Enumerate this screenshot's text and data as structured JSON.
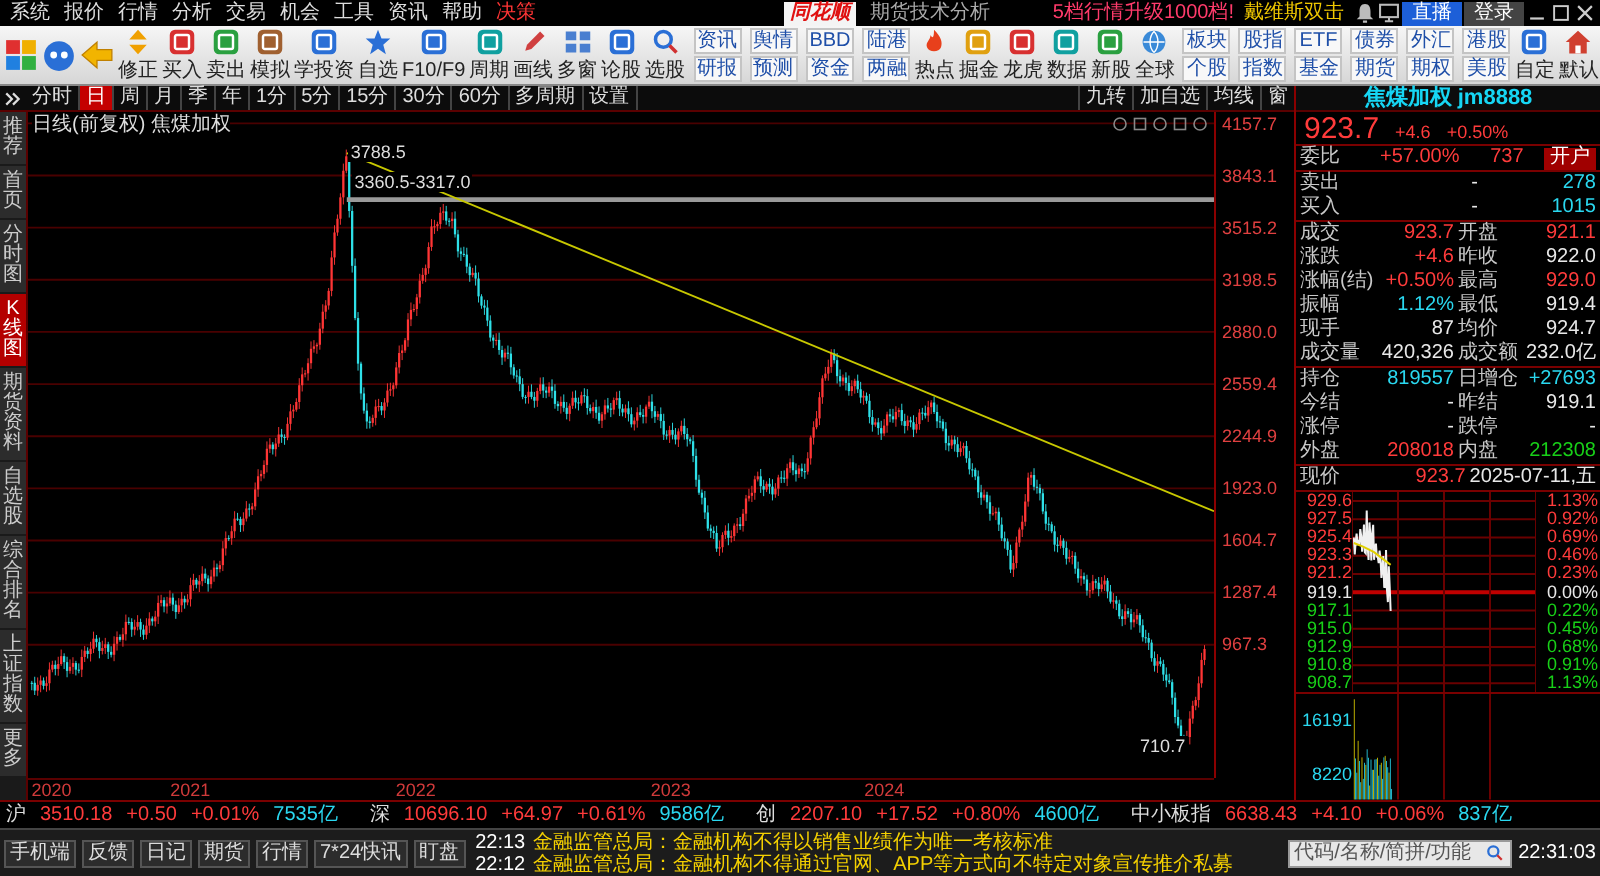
{
  "menu_bar": {
    "items": [
      {
        "label": "系统",
        "kind": "normal"
      },
      {
        "label": "报价",
        "kind": "normal"
      },
      {
        "label": "行情",
        "kind": "normal"
      },
      {
        "label": "分析",
        "kind": "normal"
      },
      {
        "label": "交易",
        "kind": "normal"
      },
      {
        "label": "机会",
        "kind": "normal"
      },
      {
        "label": "工具",
        "kind": "normal"
      },
      {
        "label": "资讯",
        "kind": "normal"
      },
      {
        "label": "帮助",
        "kind": "normal"
      },
      {
        "label": "决策",
        "kind": "highlight"
      }
    ],
    "logo": "同花顺",
    "app_title": "期货技术分析",
    "promo": "5档行情升级1000档!",
    "user": "戴维斯双击",
    "buttons": [
      "直播",
      "登录"
    ]
  },
  "toolbar": {
    "tools": [
      {
        "kind": "icon",
        "label": "修正"
      },
      {
        "kind": "icon",
        "label": "买入"
      },
      {
        "kind": "icon",
        "label": "卖出"
      },
      {
        "kind": "icon",
        "label": "模拟"
      },
      {
        "kind": "icon",
        "label": "学投资"
      },
      {
        "kind": "icon",
        "label": "自选"
      },
      {
        "kind": "icon",
        "label": "F10/F9"
      },
      {
        "kind": "icon",
        "label": "周期"
      },
      {
        "kind": "icon",
        "label": "画线"
      },
      {
        "kind": "icon",
        "label": "多窗"
      },
      {
        "kind": "icon",
        "label": "论股"
      },
      {
        "kind": "icon",
        "label": "选股"
      },
      {
        "kind": "pair",
        "labels": [
          "资讯",
          "研报"
        ]
      },
      {
        "kind": "pair",
        "labels": [
          "舆情",
          "预测"
        ]
      },
      {
        "kind": "pair",
        "labels": [
          "BBD",
          "资金"
        ]
      },
      {
        "kind": "pair",
        "labels": [
          "陆港",
          "两融"
        ]
      },
      {
        "kind": "icon",
        "label": "热点"
      },
      {
        "kind": "icon",
        "label": "掘金"
      },
      {
        "kind": "icon",
        "label": "龙虎"
      },
      {
        "kind": "icon",
        "label": "数据"
      },
      {
        "kind": "icon",
        "label": "新股"
      },
      {
        "kind": "icon",
        "label": "全球"
      },
      {
        "kind": "pair",
        "labels": [
          "板块",
          "个股"
        ]
      },
      {
        "kind": "pair",
        "labels": [
          "股指",
          "指数"
        ]
      },
      {
        "kind": "pair",
        "labels": [
          "ETF",
          "基金"
        ]
      },
      {
        "kind": "pair",
        "labels": [
          "债券",
          "期货"
        ]
      },
      {
        "kind": "pair",
        "labels": [
          "外汇",
          "期权"
        ]
      },
      {
        "kind": "pair",
        "labels": [
          "港股",
          "美股"
        ]
      },
      {
        "kind": "icon",
        "label": "自定"
      },
      {
        "kind": "icon",
        "label": "默认"
      }
    ]
  },
  "period_bar": {
    "periods": [
      {
        "label": "分时",
        "selected": false
      },
      {
        "label": "日",
        "selected": true
      },
      {
        "label": "周",
        "selected": false
      },
      {
        "label": "月",
        "selected": false
      },
      {
        "label": "季",
        "selected": false
      },
      {
        "label": "年",
        "selected": false
      },
      {
        "label": "1分",
        "selected": false
      },
      {
        "label": "5分",
        "selected": false
      },
      {
        "label": "15分",
        "selected": false
      },
      {
        "label": "30分",
        "selected": false
      },
      {
        "label": "60分",
        "selected": false
      },
      {
        "label": "多周期",
        "selected": false
      },
      {
        "label": "设置",
        "selected": false
      }
    ],
    "tools": [
      "九转",
      "加自选",
      "均线",
      "窗"
    ]
  },
  "sidebar": {
    "items": [
      {
        "label": "推荐",
        "selected": false
      },
      {
        "label": "首页",
        "selected": false
      },
      {
        "label": "分时图",
        "selected": false
      },
      {
        "label": "K线图",
        "selected": true
      },
      {
        "label": "期货资料",
        "selected": false
      },
      {
        "label": "自选股",
        "selected": false
      },
      {
        "label": "综合排名",
        "selected": false
      },
      {
        "label": "上证指数",
        "selected": false
      },
      {
        "label": "更多",
        "selected": false
      }
    ]
  },
  "chart": {
    "header": "日线(前复权) 焦煤加权",
    "price_ticks": [
      "4157.7",
      "3843.1",
      "3515.2",
      "3198.5",
      "2880.0",
      "2559.4",
      "2244.9",
      "1923.0",
      "1604.7",
      "1287.4",
      "967.3"
    ],
    "year_labels": [
      "2020",
      "2021",
      "2022",
      "2023",
      "2024"
    ],
    "annotations": [
      {
        "kind": "high",
        "text": "3788.5"
      },
      {
        "kind": "range",
        "text": "3360.5-3317.0"
      },
      {
        "kind": "low",
        "text": "710.7"
      }
    ]
  },
  "quote": {
    "title": "焦煤加权 jm8888",
    "price_row": [
      {
        "text": "923.7",
        "kind": "up"
      },
      {
        "text": "+4.6",
        "kind": "up"
      },
      {
        "text": "+0.50%",
        "kind": "up"
      }
    ],
    "sections": [
      [
        [
          {
            "text": "委比",
            "kind": "label"
          },
          {
            "text": "+57.00%",
            "kind": "up"
          },
          {
            "text": "737",
            "kind": "up"
          },
          {
            "text": "开户",
            "kind": "button"
          }
        ]
      ],
      [
        [
          {
            "text": "卖出",
            "kind": "label"
          },
          {
            "text": "-",
            "kind": "flat"
          },
          {
            "text": "278",
            "kind": "info"
          }
        ],
        [
          {
            "text": "买入",
            "kind": "label"
          },
          {
            "text": "-",
            "kind": "flat"
          },
          {
            "text": "1015",
            "kind": "info"
          }
        ]
      ],
      [
        [
          {
            "text": "成交",
            "kind": "label"
          },
          {
            "text": "923.7",
            "kind": "up"
          },
          {
            "text": "开盘",
            "kind": "label"
          },
          {
            "text": "921.1",
            "kind": "up"
          }
        ],
        [
          {
            "text": "涨跌",
            "kind": "label"
          },
          {
            "text": "+4.6",
            "kind": "up"
          },
          {
            "text": "昨收",
            "kind": "label"
          },
          {
            "text": "922.0",
            "kind": "flat"
          }
        ],
        [
          {
            "text": "涨幅(结)",
            "kind": "label"
          },
          {
            "text": "+0.50%",
            "kind": "up"
          },
          {
            "text": "最高",
            "kind": "label"
          },
          {
            "text": "929.0",
            "kind": "up"
          }
        ],
        [
          {
            "text": "振幅",
            "kind": "label"
          },
          {
            "text": "1.12%",
            "kind": "info"
          },
          {
            "text": "最低",
            "kind": "label"
          },
          {
            "text": "919.4",
            "kind": "flat"
          }
        ],
        [
          {
            "text": "现手",
            "kind": "label"
          },
          {
            "text": "87",
            "kind": "flat"
          },
          {
            "text": "均价",
            "kind": "label"
          },
          {
            "text": "924.7",
            "kind": "flat"
          }
        ],
        [
          {
            "text": "成交量",
            "kind": "label"
          },
          {
            "text": "420,326",
            "kind": "flat"
          },
          {
            "text": "成交额",
            "kind": "label"
          },
          {
            "text": "232.0亿",
            "kind": "flat"
          }
        ]
      ],
      [
        [
          {
            "text": "持仓",
            "kind": "label"
          },
          {
            "text": "819557",
            "kind": "info"
          },
          {
            "text": "日增仓",
            "kind": "label"
          },
          {
            "text": "+27693",
            "kind": "info"
          }
        ],
        [
          {
            "text": "今结",
            "kind": "label"
          },
          {
            "text": "-",
            "kind": "flat"
          },
          {
            "text": "昨结",
            "kind": "label"
          },
          {
            "text": "919.1",
            "kind": "flat"
          }
        ],
        [
          {
            "text": "涨停",
            "kind": "label"
          },
          {
            "text": "-",
            "kind": "flat"
          },
          {
            "text": "跌停",
            "kind": "label"
          },
          {
            "text": "-",
            "kind": "flat"
          }
        ],
        [
          {
            "text": "外盘",
            "kind": "label"
          },
          {
            "text": "208018",
            "kind": "up"
          },
          {
            "text": "内盘",
            "kind": "label"
          },
          {
            "text": "212308",
            "kind": "down"
          }
        ]
      ],
      [
        [
          {
            "text": "现价",
            "kind": "label"
          },
          {
            "text": "923.7",
            "kind": "up"
          },
          {
            "text": "2025-07-11,五",
            "kind": "flat"
          }
        ]
      ]
    ],
    "intraday": {
      "rows": [
        {
          "price": "929.6",
          "percent": "1.13%",
          "kind": "up"
        },
        {
          "price": "927.5",
          "percent": "0.92%",
          "kind": "up"
        },
        {
          "price": "925.4",
          "percent": "0.69%",
          "kind": "up"
        },
        {
          "price": "923.3",
          "percent": "0.46%",
          "kind": "up"
        },
        {
          "price": "921.2",
          "percent": "0.23%",
          "kind": "up"
        },
        {
          "price": "919.1",
          "percent": "0.00%",
          "kind": "flat"
        },
        {
          "price": "917.1",
          "percent": "0.22%",
          "kind": "down"
        },
        {
          "price": "915.0",
          "percent": "0.45%",
          "kind": "down"
        },
        {
          "price": "912.9",
          "percent": "0.68%",
          "kind": "down"
        },
        {
          "price": "910.8",
          "percent": "0.91%",
          "kind": "down"
        },
        {
          "price": "908.7",
          "percent": "1.13%",
          "kind": "down"
        }
      ],
      "volume_ticks": [
        "16191",
        "8220"
      ]
    }
  },
  "index_bar": [
    {
      "market": "沪",
      "price": "3510.18",
      "change": "+0.50",
      "percent": "+0.01%",
      "turnover": "7535亿",
      "kind": "up"
    },
    {
      "market": "深",
      "price": "10696.10",
      "change": "+64.97",
      "percent": "+0.61%",
      "turnover": "9586亿",
      "kind": "up"
    },
    {
      "market": "创",
      "price": "2207.10",
      "change": "+17.52",
      "percent": "+0.80%",
      "turnover": "4600亿",
      "kind": "up"
    },
    {
      "market": "中小板指",
      "price": "6638.43",
      "change": "+4.10",
      "percent": "+0.06%",
      "turnover": "837亿",
      "kind": "up"
    }
  ],
  "status_bar": {
    "tabs": [
      "手机端",
      "反馈",
      "日记",
      "期货",
      "行情",
      "7*24快讯",
      "盯盘"
    ],
    "news": [
      {
        "time": "22:13",
        "text": "金融监管总局：金融机构不得以销售业绩作为唯一考核标准"
      },
      {
        "time": "22:12",
        "text": "金融监管总局：金融机构不得通过官网、APP等方式向不特定对象宣传推介私募"
      }
    ],
    "search": {
      "placeholder": "代码/名称/简拼/功能"
    },
    "time": "22:31:03"
  }
}
